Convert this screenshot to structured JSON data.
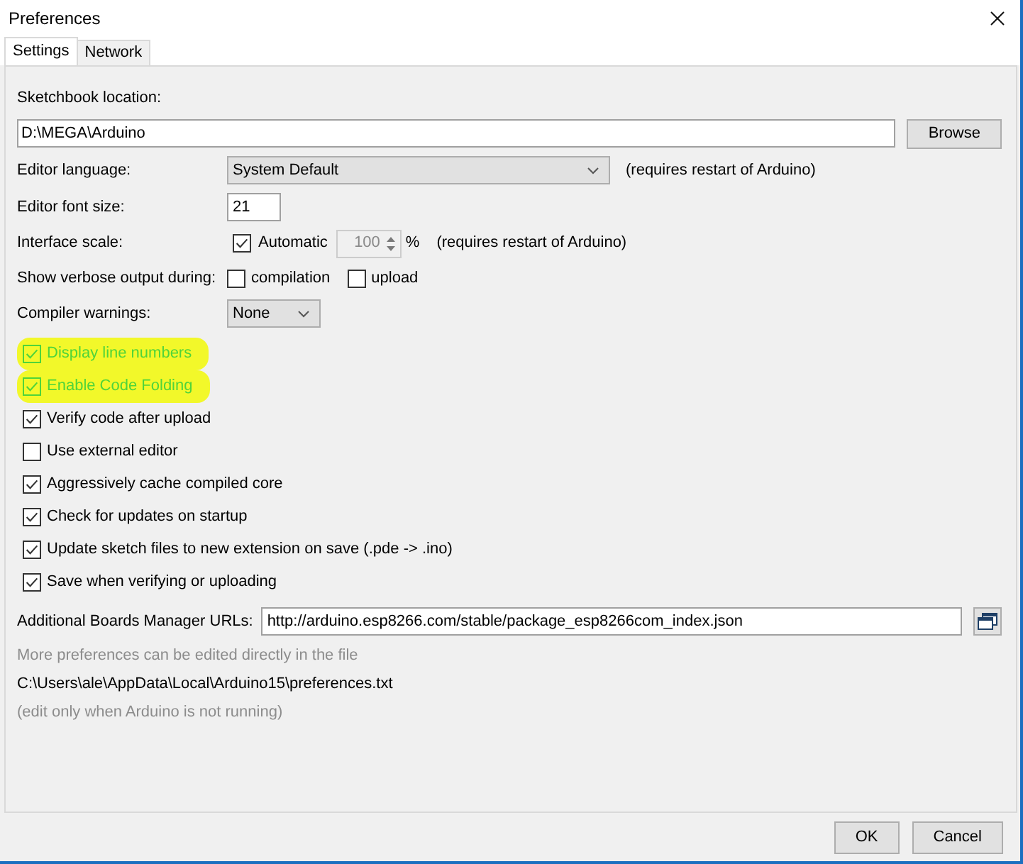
{
  "window": {
    "title": "Preferences"
  },
  "tabs": [
    {
      "label": "Settings",
      "selected": true
    },
    {
      "label": "Network",
      "selected": false
    }
  ],
  "sketchbook": {
    "label": "Sketchbook location:",
    "value": "D:\\MEGA\\Arduino",
    "button": "Browse"
  },
  "settings": [
    {
      "kind": "select",
      "label": "Editor language:",
      "value": "System Default",
      "note": "(requires restart of Arduino)"
    },
    {
      "kind": "text",
      "label": "Editor font size:",
      "value": "21"
    },
    {
      "kind": "scale",
      "label": "Interface scale:",
      "checkbox": {
        "label": "Automatic",
        "checked": true
      },
      "spinner": {
        "value": "100",
        "disabled": true
      },
      "unit": "%",
      "note": "(requires restart of Arduino)"
    },
    {
      "kind": "checks",
      "label": "Show verbose output during:",
      "options": [
        {
          "label": "compilation",
          "checked": false
        },
        {
          "label": "upload",
          "checked": false
        }
      ]
    },
    {
      "kind": "select",
      "label": "Compiler warnings:",
      "value": "None"
    }
  ],
  "options": [
    {
      "label": "Display line numbers",
      "checked": true,
      "highlighted": true
    },
    {
      "label": "Enable Code Folding",
      "checked": true,
      "highlighted": true
    },
    {
      "label": "Verify code after upload",
      "checked": true,
      "highlighted": false
    },
    {
      "label": "Use external editor",
      "checked": false,
      "highlighted": false
    },
    {
      "label": "Aggressively cache compiled core",
      "checked": true,
      "highlighted": false
    },
    {
      "label": "Check for updates on startup",
      "checked": true,
      "highlighted": false
    },
    {
      "label": "Update sketch files to new extension on save (.pde -> .ino)",
      "checked": true,
      "highlighted": false
    },
    {
      "label": "Save when verifying or uploading",
      "checked": true,
      "highlighted": false
    }
  ],
  "boards_urls": {
    "label": "Additional Boards Manager URLs:",
    "value": "http://arduino.esp8266.com/stable/package_esp8266com_index.json"
  },
  "info": [
    {
      "text": "More preferences can be edited directly in the file",
      "dimmed": true
    },
    {
      "text": "C:\\Users\\ale\\AppData\\Local\\Arduino15\\preferences.txt",
      "dimmed": false
    },
    {
      "text": "(edit only when Arduino is not running)",
      "dimmed": true
    }
  ],
  "buttons": [
    "OK",
    "Cancel"
  ]
}
